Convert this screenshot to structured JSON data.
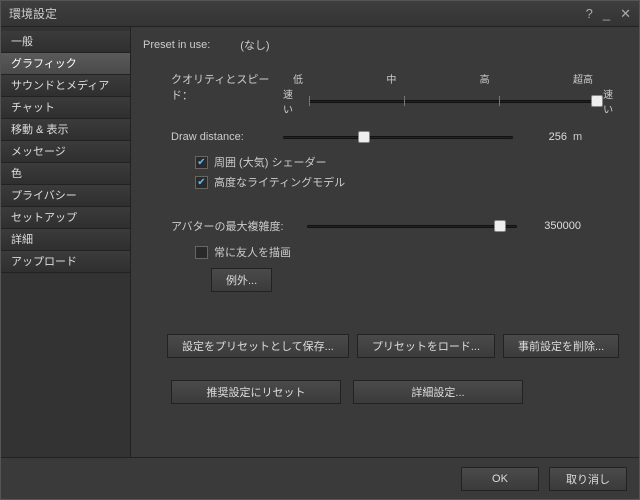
{
  "window": {
    "title": "環境設定"
  },
  "sidebar": {
    "items": [
      {
        "label": "一般"
      },
      {
        "label": "グラフィック"
      },
      {
        "label": "サウンドとメディア"
      },
      {
        "label": "チャット"
      },
      {
        "label": "移動 & 表示"
      },
      {
        "label": "メッセージ"
      },
      {
        "label": "色"
      },
      {
        "label": "プライバシー"
      },
      {
        "label": "セットアップ"
      },
      {
        "label": "詳細"
      },
      {
        "label": "アップロード"
      }
    ],
    "selected_index": 1
  },
  "content": {
    "preset_label": "Preset in use:",
    "preset_value": "(なし)",
    "quality_label": "クオリティとスピード：",
    "quality_ticks": [
      "低",
      "中",
      "高",
      "超高"
    ],
    "quality_left": "速い",
    "quality_right": "速い",
    "quality_position_pct": 100,
    "draw_distance_label": "Draw distance:",
    "draw_distance_value": "256",
    "draw_distance_unit": "m",
    "draw_distance_pct": 35,
    "chk_atmos_label": "周囲 (大気) シェーダー",
    "chk_atmos_checked": true,
    "chk_lighting_label": "高度なライティングモデル",
    "chk_lighting_checked": true,
    "avatar_complexity_label": "アバターの最大複雑度:",
    "avatar_complexity_value": "350000",
    "avatar_complexity_pct": 92,
    "chk_friends_label": "常に友人を描画",
    "chk_friends_checked": false,
    "exceptions_btn": "例外...",
    "save_preset_btn": "設定をプリセットとして保存...",
    "load_preset_btn": "プリセットをロード...",
    "delete_preset_btn": "事前設定を削除...",
    "reset_btn": "推奨設定にリセット",
    "advanced_btn": "詳細設定..."
  },
  "footer": {
    "ok": "OK",
    "cancel": "取り消し"
  }
}
